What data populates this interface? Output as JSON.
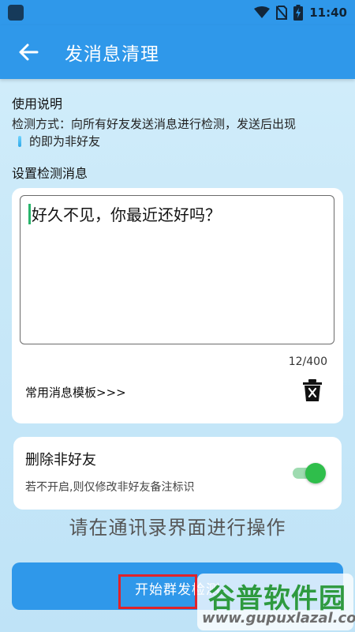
{
  "status_bar": {
    "time": "11:40"
  },
  "app_bar": {
    "title": "发消息清理"
  },
  "usage": {
    "heading": "使用说明",
    "line1": "检测方式：向所有好友发送消息进行检测，发送后出现",
    "line2": "的即为非好友"
  },
  "message": {
    "heading": "设置检测消息",
    "text": "好久不见，你最近还好吗？",
    "counter": "12/400",
    "template_link": "常用消息模板>>>"
  },
  "toggle": {
    "title": "删除非好友",
    "hint": "若不开启,则仅修改非好友备注标识",
    "enabled": true
  },
  "instruction": "请在通讯录界面进行操作",
  "start_button": {
    "label": "开始群发检测"
  },
  "watermark": {
    "brand": "谷普软件园",
    "url": "www.gupuxlazal.com"
  },
  "colors": {
    "primary": "#2f98ea",
    "switch_on": "#2fbe4b",
    "highlight": "#e0232a",
    "watermark_green": "#2e9a3f"
  }
}
